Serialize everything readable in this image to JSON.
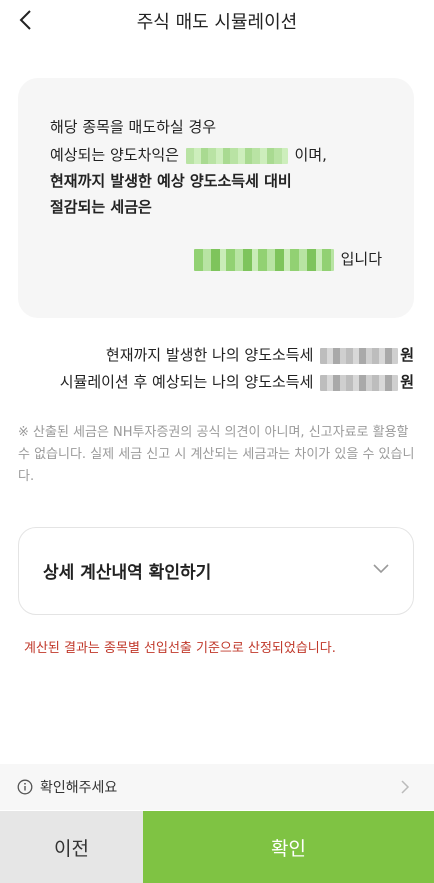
{
  "header": {
    "title": "주식 매도 시뮬레이션",
    "back_icon": "chevron-left-icon"
  },
  "result_card": {
    "line1": "해당 종목을 매도하실 경우",
    "line2_prefix": "예상되는 양도차익은",
    "line2_suffix": "이며,",
    "line3": "현재까지 발생한 예상 양도소득세 대비",
    "line4": "절감되는 세금은",
    "amount_suffix": "입니다"
  },
  "summary": {
    "current_tax_label": "현재까지 발생한 나의 양도소득세",
    "simulated_tax_label": "시뮬레이션 후 예상되는 나의 양도소득세",
    "currency_unit": "원"
  },
  "notice": "※ 산출된 세금은 NH투자증권의 공식 의견이 아니며, 신고자료로 활용할 수 없습니다. 실제 세금 신고 시 계산되는 세금과는 차이가 있을 수 있습니다.",
  "details_accordion": {
    "title": "상세 계산내역 확인하기",
    "icon": "chevron-down-icon"
  },
  "calc_note": "계산된 결과는 종목별 선입선출 기준으로 산정되었습니다.",
  "confirm_bar": {
    "label": "확인해주세요",
    "icon": "info-icon"
  },
  "buttons": {
    "prev": "이전",
    "confirm": "확인"
  },
  "colors": {
    "accent_green": "#7fc343",
    "warning_red": "#c0392b",
    "card_bg": "#f6f6f6"
  }
}
